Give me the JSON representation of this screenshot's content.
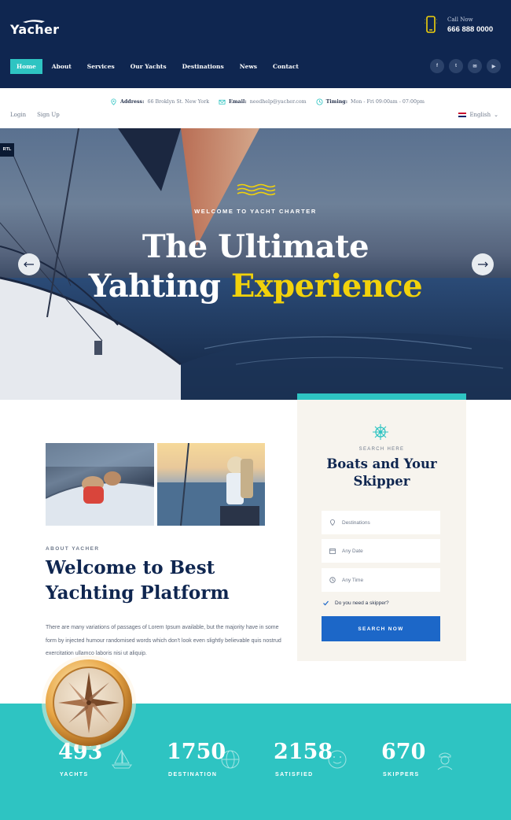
{
  "brand": {
    "name": "Yacher"
  },
  "call": {
    "label": "Call Now",
    "number": "666 888 0000"
  },
  "nav": {
    "items": [
      "Home",
      "About",
      "Services",
      "Our Yachts",
      "Destinations",
      "News",
      "Contact"
    ],
    "active": "Home"
  },
  "socials": [
    {
      "icon": "facebook-icon",
      "glyph": "f"
    },
    {
      "icon": "twitter-icon",
      "glyph": "t"
    },
    {
      "icon": "email-icon",
      "glyph": "✉"
    },
    {
      "icon": "youtube-icon",
      "glyph": "▶"
    }
  ],
  "infobar": {
    "address_label": "Address:",
    "address_value": "66 Broklyn St. New York",
    "email_label": "Email:",
    "email_value": "needhelp@yacher.com",
    "timing_label": "Timing:",
    "timing_value": "Mon - Fri 09:00am - 07:00pm",
    "login": "Login",
    "signup": "Sign Up",
    "language": "English"
  },
  "hero": {
    "rtl_badge": "RTL",
    "eyebrow": "WELCOME TO YACHT CHARTER",
    "title_line1": "The Ultimate",
    "title_line2_white": "Yahting",
    "title_line2_highlight": "Experience"
  },
  "about": {
    "eyebrow": "ABOUT YACHER",
    "title_line1": "Welcome to Best",
    "title_line2": "Yachting Platform",
    "text": "There are many variations of passages of Lorem Ipsum available, but the majority have in some form by injected humour randomised words which don't look even slightly believable quis nostrud exercitation ullamco laboris nisi ut aliquip."
  },
  "booking": {
    "eyebrow": "SEARCH HERE",
    "title_line1": "Boats and Your",
    "title_line2": "Skipper",
    "destinations_placeholder": "Destinations",
    "date_placeholder": "Any Date",
    "time_placeholder": "Any Time",
    "skipper_question": "Do you need a skipper?",
    "button": "SEARCH NOW"
  },
  "stats": [
    {
      "number": "493",
      "label": "YACHTS",
      "icon": "sailboat-icon"
    },
    {
      "number": "1750",
      "label": "DESTINATION",
      "icon": "globe-icon"
    },
    {
      "number": "2158",
      "label": "SATISFIED",
      "icon": "smile-icon"
    },
    {
      "number": "670",
      "label": "SKIPPERS",
      "icon": "captain-icon"
    }
  ],
  "colors": {
    "navy": "#0f2650",
    "teal": "#2ec4c2",
    "highlight_yellow": "#f2d20b",
    "button_blue": "#1c67c8",
    "card_bg": "#f7f4ee"
  }
}
